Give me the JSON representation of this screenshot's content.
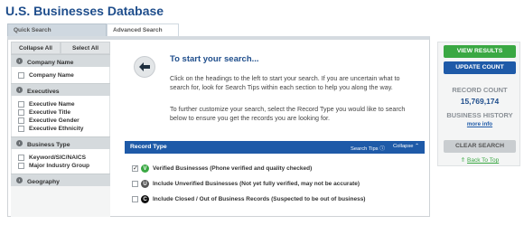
{
  "page": {
    "title": "U.S. Businesses Database"
  },
  "tabs": {
    "quick": "Quick Search",
    "advanced": "Advanced Search"
  },
  "sidebar": {
    "collapse_all": "Collapse All",
    "select_all": "Select All",
    "sections": [
      {
        "header": "Company Name",
        "items": [
          "Company Name"
        ]
      },
      {
        "header": "Executives",
        "items": [
          "Executive Name",
          "Executive Title",
          "Executive Gender",
          "Executive Ethnicity"
        ]
      },
      {
        "header": "Business Type",
        "items": [
          "Keyword/SIC/NAICS",
          "Major Industry Group"
        ]
      },
      {
        "header": "Geography",
        "items": []
      }
    ]
  },
  "intro": {
    "title": "To start your search...",
    "paragraph1": "Click on the headings to the left to start your search. If you are uncertain what to search for, look for Search Tips within each section to help you along the way.",
    "paragraph2": "To further customize your search, select the Record Type you would like to search below to ensure you get the records you are looking for."
  },
  "record_type": {
    "title": "Record Type",
    "search_tips": "Search Tips",
    "collapse": "Collapse",
    "options": [
      {
        "badge": "V",
        "color": "#3aa843",
        "label": "Verified Businesses (Phone verified and quality checked)",
        "checked": true
      },
      {
        "badge": "U",
        "color": "#555555",
        "label": "Include Unverified Businesses (Not yet fully verified, may not be accurate)",
        "checked": false
      },
      {
        "badge": "C",
        "color": "#111111",
        "label": "Include Closed / Out of Business Records (Suspected to be out of business)",
        "checked": false
      }
    ]
  },
  "right_panel": {
    "view_results": "VIEW RESULTS",
    "update_count": "UPDATE COUNT",
    "record_count_label": "RECORD COUNT",
    "record_count_value": "15,769,174",
    "business_history_label": "BUSINESS HISTORY",
    "more_info": "more info",
    "clear_search": "CLEAR SEARCH",
    "back_to_top": "Back To Top"
  },
  "colors": {
    "brand_blue": "#1e5aa8",
    "title_blue": "#1f4e8c",
    "accent_green": "#3aa843"
  }
}
